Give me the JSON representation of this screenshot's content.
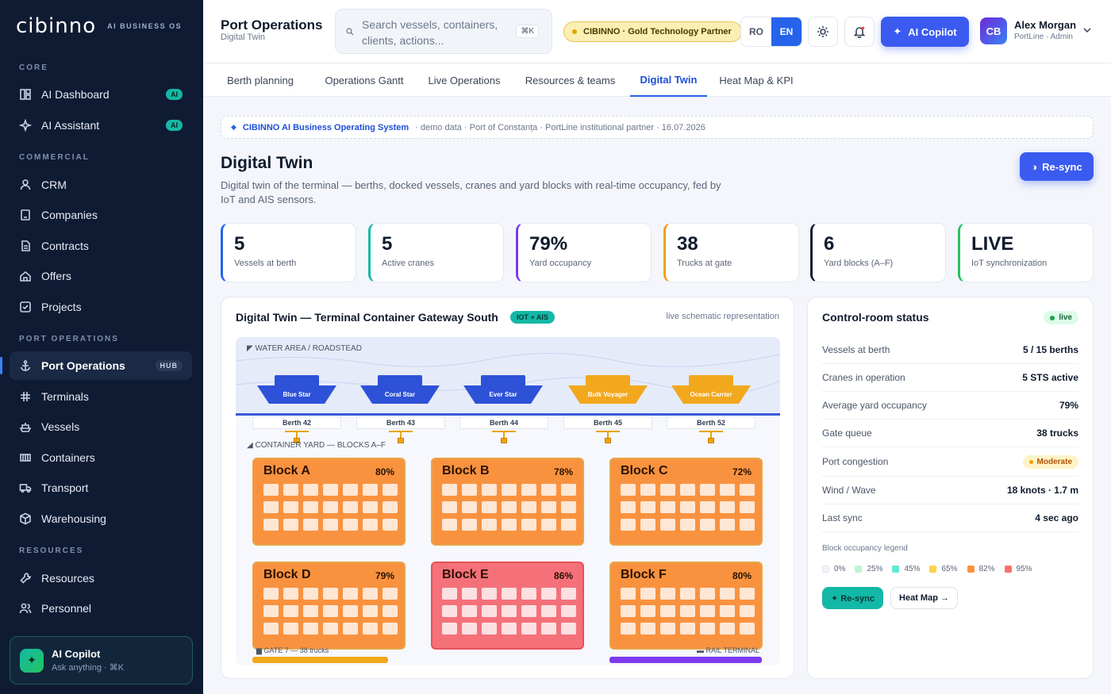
{
  "brand": {
    "logo": "cibinno",
    "tagline": "AI BUSINESS OS"
  },
  "sidebar": {
    "sections": [
      {
        "title": "CORE",
        "items": [
          {
            "label": "AI Dashboard",
            "icon": "dashboard-icon",
            "badge": "AI"
          },
          {
            "label": "AI Assistant",
            "icon": "sparkle-icon",
            "badge": "AI"
          }
        ]
      },
      {
        "title": "COMMERCIAL",
        "items": [
          {
            "label": "CRM",
            "icon": "user-icon"
          },
          {
            "label": "Companies",
            "icon": "building-icon"
          },
          {
            "label": "Contracts",
            "icon": "document-icon"
          },
          {
            "label": "Offers",
            "icon": "home-icon"
          },
          {
            "label": "Projects",
            "icon": "checkbox-icon"
          }
        ]
      },
      {
        "title": "PORT OPERATIONS",
        "items": [
          {
            "label": "Port Operations",
            "icon": "anchor-icon",
            "badge": "HUB",
            "active": true
          },
          {
            "label": "Terminals",
            "icon": "grid-icon"
          },
          {
            "label": "Vessels",
            "icon": "ship-icon"
          },
          {
            "label": "Containers",
            "icon": "container-icon"
          },
          {
            "label": "Transport",
            "icon": "truck-icon"
          },
          {
            "label": "Warehousing",
            "icon": "box-icon"
          }
        ]
      },
      {
        "title": "RESOURCES",
        "items": [
          {
            "label": "Resources",
            "icon": "wrench-icon"
          },
          {
            "label": "Personnel",
            "icon": "users-icon"
          }
        ]
      }
    ],
    "copilot": {
      "title": "AI Copilot",
      "subtitle": "Ask anything · ⌘K"
    }
  },
  "header": {
    "title": "Port Operations",
    "subtitle": "Digital Twin",
    "search_placeholder": "Search vessels, containers, clients, actions...",
    "search_shortcut": "⌘K",
    "partner_badge": "CIBINNO · Gold Technology Partner",
    "languages": [
      "RO",
      "EN"
    ],
    "active_language": "EN",
    "copilot_label": "AI Copilot",
    "user": {
      "initials": "CB",
      "name": "Alex Morgan",
      "role": "PortLine · Admin"
    }
  },
  "tabs": [
    "Berth planning",
    "Operations Gantt",
    "Live Operations",
    "Resources & teams",
    "Digital Twin",
    "Heat Map & KPI"
  ],
  "active_tab": "Digital Twin",
  "crumb": {
    "brand": "CIBINNO AI Business Operating System",
    "meta": "· demo data · Port of Constanța · PortLine institutional partner · 16.07.2026"
  },
  "page": {
    "title": "Digital Twin",
    "description": "Digital twin of the terminal — berths, docked vessels, cranes and yard blocks with real-time occupancy, fed by IoT and AIS sensors.",
    "resync_label": "Re-sync"
  },
  "kpis": [
    {
      "value": "5",
      "label": "Vessels at berth",
      "color": "#2563eb"
    },
    {
      "value": "5",
      "label": "Active cranes",
      "color": "#14b8a6"
    },
    {
      "value": "79%",
      "label": "Yard occupancy",
      "color": "#7c3aed"
    },
    {
      "value": "38",
      "label": "Trucks at gate",
      "color": "#f59e0b"
    },
    {
      "value": "6",
      "label": "Yard blocks (A–F)",
      "color": "#0f1b33"
    },
    {
      "value": "LIVE",
      "label": "IoT synchronization",
      "color": "#22c55e"
    }
  ],
  "twin": {
    "title": "Digital Twin — Terminal Container Gateway South",
    "badge": "IOT + AIS",
    "subtitle": "live schematic representation",
    "water_label": "WATER AREA / ROADSTEAD",
    "yard_label": "CONTAINER YARD — BLOCKS A–F",
    "ships": [
      {
        "name": "Blue Star",
        "berth": "Berth 42",
        "color": "#2d52d8"
      },
      {
        "name": "Coral Star",
        "berth": "Berth 43",
        "color": "#2d52d8"
      },
      {
        "name": "Ever Star",
        "berth": "Berth 44",
        "color": "#2d52d8"
      },
      {
        "name": "Bulk Voyager",
        "berth": "Berth 45",
        "color": "#f2a81d"
      },
      {
        "name": "Ocean Carrier",
        "berth": "Berth 52",
        "color": "#f2a81d"
      }
    ],
    "blocks": [
      {
        "name": "Block A",
        "pct": "80%",
        "color": "#f9923f"
      },
      {
        "name": "Block B",
        "pct": "78%",
        "color": "#f9923f"
      },
      {
        "name": "Block C",
        "pct": "72%",
        "color": "#f9923f"
      },
      {
        "name": "Block D",
        "pct": "79%",
        "color": "#f9923f"
      },
      {
        "name": "Block E",
        "pct": "86%",
        "color": "#f4717a"
      },
      {
        "name": "Block F",
        "pct": "80%",
        "color": "#f9923f"
      }
    ],
    "gate_label": "GATE 7 — 38 trucks",
    "rail_label": "RAIL TERMINAL"
  },
  "control": {
    "title": "Control-room status",
    "live": "live",
    "rows": [
      {
        "k": "Vessels at berth",
        "v": "5 / 15 berths"
      },
      {
        "k": "Cranes in operation",
        "v": "5 STS active"
      },
      {
        "k": "Average yard occupancy",
        "v": "79%"
      },
      {
        "k": "Gate queue",
        "v": "38 trucks"
      },
      {
        "k": "Port congestion",
        "v": "Moderate",
        "badge": true
      },
      {
        "k": "Wind / Wave",
        "v": "18 knots · 1.7 m"
      },
      {
        "k": "Last sync",
        "v": "4 sec ago"
      }
    ],
    "legend_title": "Block occupancy legend",
    "legend": [
      {
        "label": "0%",
        "color": "#f1f4f9"
      },
      {
        "label": "25%",
        "color": "#bbf7d0"
      },
      {
        "label": "45%",
        "color": "#5eead4"
      },
      {
        "label": "65%",
        "color": "#fcd34d"
      },
      {
        "label": "82%",
        "color": "#fb923c"
      },
      {
        "label": "95%",
        "color": "#f87171"
      }
    ],
    "resync_label": "✦ Re-sync",
    "heatmap_label": "Heat Map →"
  }
}
